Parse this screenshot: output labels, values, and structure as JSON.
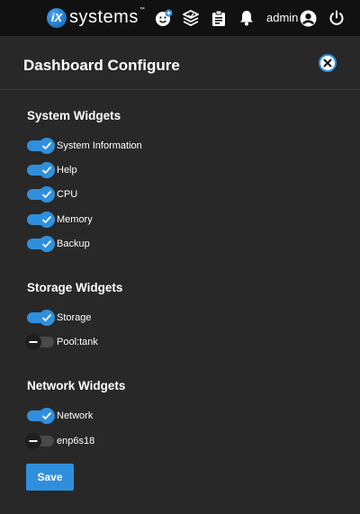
{
  "topbar": {
    "logo_mark": "iX",
    "logo_text": "systems",
    "logo_tm": "™",
    "user": "admin",
    "icons": [
      "smile-feedback-icon",
      "truecommand-icon",
      "clipboard-tasks-icon",
      "bell-icon",
      "account-circle-icon",
      "power-icon"
    ]
  },
  "panel": {
    "title": "Dashboard Configure",
    "save_label": "Save"
  },
  "sections": [
    {
      "title": "System Widgets",
      "widgets": [
        {
          "label": "System Information",
          "enabled": true
        },
        {
          "label": "Help",
          "enabled": true
        },
        {
          "label": "CPU",
          "enabled": true
        },
        {
          "label": "Memory",
          "enabled": true
        },
        {
          "label": "Backup",
          "enabled": true
        }
      ]
    },
    {
      "title": "Storage Widgets",
      "widgets": [
        {
          "label": "Storage",
          "enabled": true
        },
        {
          "label": "Pool:tank",
          "enabled": false
        }
      ]
    },
    {
      "title": "Network Widgets",
      "widgets": [
        {
          "label": "Network",
          "enabled": true
        },
        {
          "label": "enp6s18",
          "enabled": false
        }
      ]
    }
  ],
  "colors": {
    "accent": "#2f8fdc",
    "topbar": "#111111",
    "panel": "#282828",
    "toggle_off": "#4a4a4a"
  }
}
